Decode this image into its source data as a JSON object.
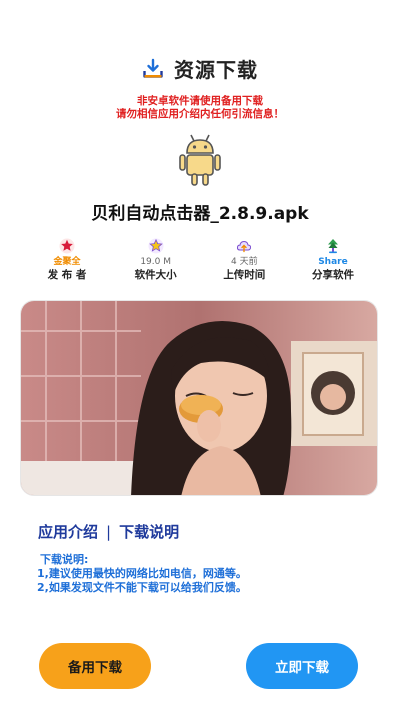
{
  "header": {
    "title": "资源下载",
    "icon": "download-tray-icon"
  },
  "warning": {
    "line1": "非安卓软件请使用备用下载",
    "line2": "请勿相信应用介绍内任何引流信息！"
  },
  "app": {
    "name": "贝利自动点击器_2.8.9.apk",
    "icon": "android-robot-icon"
  },
  "stats": [
    {
      "icon": "red-star-badge-icon",
      "value": "金聚全",
      "label": "发 布 者"
    },
    {
      "icon": "yellow-star-badge-icon",
      "value": "19.0 M",
      "label": "软件大小"
    },
    {
      "icon": "upload-cloud-icon",
      "value": "4 天前",
      "label": "上传时间"
    },
    {
      "icon": "share-tree-icon",
      "value": "Share",
      "label": "分享软件"
    }
  ],
  "tabs": {
    "intro": "应用介绍",
    "separator": "|",
    "notes": "下载说明"
  },
  "notes": {
    "head": "下载说明:",
    "line1": "1,建议使用最快的网络比如电信，网通等。",
    "line2": "2,如果发现文件不能下载可以给我们反馈。"
  },
  "buttons": {
    "backup": "备用下载",
    "download_now": "立即下载"
  },
  "colors": {
    "warning": "#e02020",
    "tab": "#1f3a9c",
    "notes": "#1e6fd8",
    "backup_btn": "#f7a11a",
    "download_btn": "#2196f3"
  }
}
